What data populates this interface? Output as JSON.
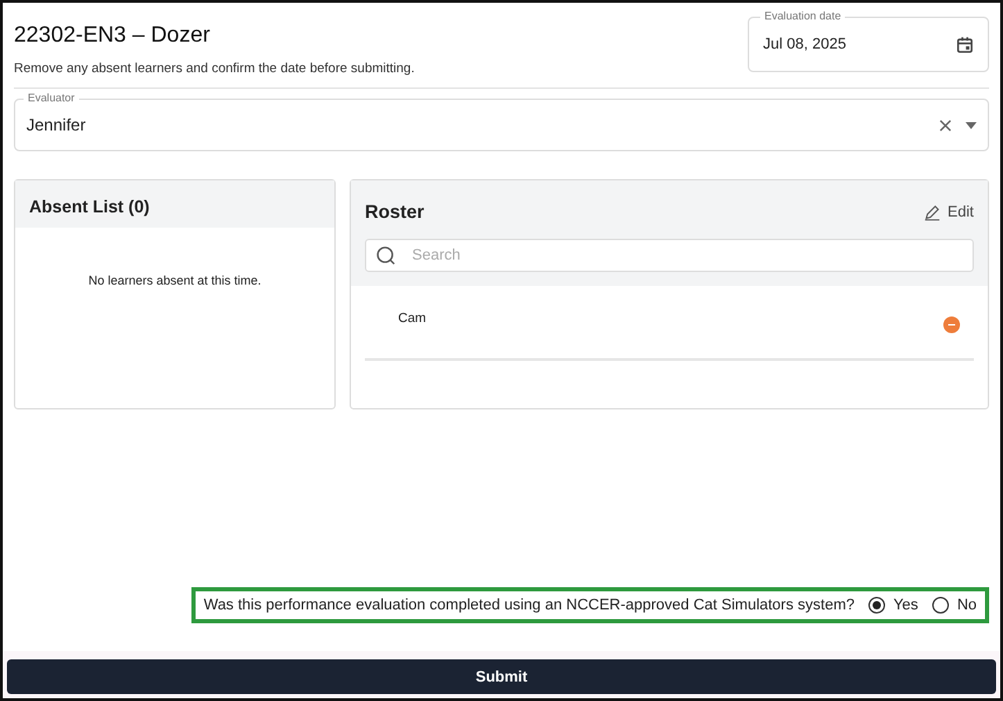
{
  "header": {
    "title": "22302-EN3 – Dozer",
    "subtitle": "Remove any absent learners and confirm the date before submitting."
  },
  "evaluation_date": {
    "label": "Evaluation date",
    "value": "Jul 08, 2025"
  },
  "evaluator": {
    "label": "Evaluator",
    "value": "Jennifer"
  },
  "absent_list": {
    "title": "Absent List (0)",
    "empty_message": "No learners absent at this time."
  },
  "roster": {
    "title": "Roster",
    "edit_label": "Edit",
    "search": {
      "placeholder": "Search"
    },
    "learners": [
      {
        "name": "Cam"
      }
    ]
  },
  "simulator_question": {
    "text": "Was this performance evaluation completed using an NCCER-approved Cat Simulators system?",
    "options": [
      {
        "label": "Yes",
        "selected": true
      },
      {
        "label": "No",
        "selected": false
      }
    ]
  },
  "submit_label": "Submit"
}
